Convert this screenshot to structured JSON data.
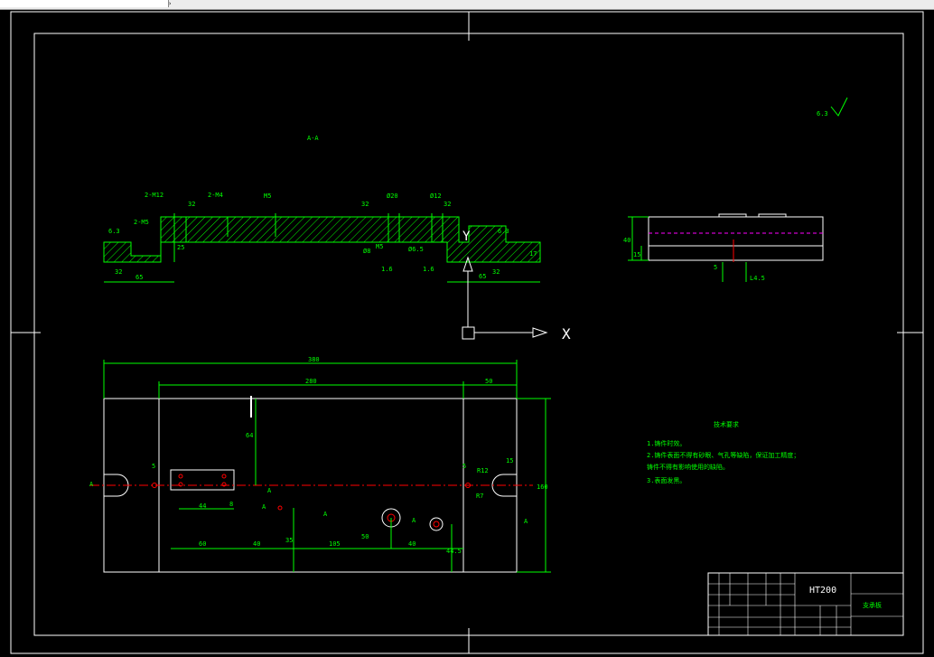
{
  "toolbar": {
    "field_text": "",
    "arrow": "›"
  },
  "colors": {
    "background": "#000000",
    "frame": "#ffffff",
    "geometry": "#00ff00",
    "centerline": "#ff0000",
    "hidden": "#ff00ff",
    "hatch": "#00ff00"
  },
  "section": {
    "label": "A-A",
    "roughness_mark": "6.3"
  },
  "section_dims": [
    "2-M12",
    "32",
    "2-M4",
    "M5",
    "32",
    "Ø20",
    "Ø12",
    "32",
    "6.3",
    "2-M5",
    "6.3",
    "25",
    "32",
    "65",
    "Ø8",
    "M5",
    "Ø6.5",
    "1.6",
    "1.6",
    "65",
    "32",
    "17"
  ],
  "ucs": {
    "x_label": "X",
    "y_label": "Y"
  },
  "side_view": {
    "dims": [
      "40",
      "15",
      "5",
      "L4.5"
    ]
  },
  "plan_view": {
    "dims_top": [
      "380",
      "280",
      "50"
    ],
    "dims_side": [
      "64",
      "160",
      "15",
      "R12",
      "R7",
      "5",
      "5"
    ],
    "dims_bottom": [
      "44",
      "8",
      "60",
      "40",
      "35",
      "105",
      "40",
      "50",
      "44.5"
    ],
    "section_marks": [
      "A",
      "A",
      "A",
      "A",
      "A",
      "A"
    ]
  },
  "tech_notes": {
    "title": "技术要求",
    "lines": [
      "1.铸件时效。",
      "2.铸件表面不得有砂眼、气孔等缺陷，保证加工精度；",
      "铸件不得有影响使用的缺陷。",
      "3.表面发黑。"
    ]
  },
  "title_block": {
    "material": "HT200",
    "part_name": "支承板"
  }
}
